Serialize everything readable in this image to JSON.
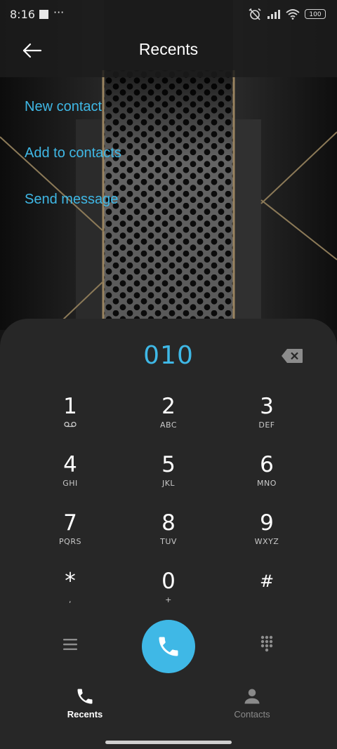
{
  "status_bar": {
    "time": "8:16",
    "battery": "100"
  },
  "header": {
    "title": "Recents"
  },
  "actions": [
    {
      "label": "New contact"
    },
    {
      "label": "Add to contacts"
    },
    {
      "label": "Send message"
    }
  ],
  "dialer": {
    "number": "010",
    "keys": [
      {
        "digit": "1",
        "letters": ""
      },
      {
        "digit": "2",
        "letters": "ABC"
      },
      {
        "digit": "3",
        "letters": "DEF"
      },
      {
        "digit": "4",
        "letters": "GHI"
      },
      {
        "digit": "5",
        "letters": "JKL"
      },
      {
        "digit": "6",
        "letters": "MNO"
      },
      {
        "digit": "7",
        "letters": "PQRS"
      },
      {
        "digit": "8",
        "letters": "TUV"
      },
      {
        "digit": "9",
        "letters": "WXYZ"
      },
      {
        "digit": "*",
        "letters": ","
      },
      {
        "digit": "0",
        "letters": "+"
      },
      {
        "digit": "#",
        "letters": ""
      }
    ]
  },
  "bottom_nav": {
    "recents_label": "Recents",
    "contacts_label": "Contacts"
  },
  "colors": {
    "accent": "#3fb8e6",
    "panel": "#272727",
    "active_tab": "#ffffff",
    "inactive_tab": "#8a8a8a"
  },
  "icons": {
    "voicemail": "voicemail-icon",
    "backspace": "backspace-icon",
    "call": "phone-icon",
    "menu": "menu-icon",
    "dialpad": "dialpad-icon",
    "recents": "phone-icon",
    "contacts": "person-icon"
  }
}
